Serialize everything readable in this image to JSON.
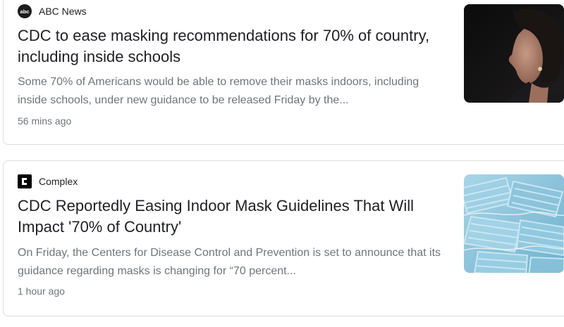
{
  "articles": [
    {
      "source": "ABC News",
      "source_icon": "abc-news-logo-icon",
      "headline": "CDC to ease masking recommendations for 70% of country, including inside schools",
      "snippet": "Some 70% of Americans would be able to remove their masks indoors, including inside schools, under new guidance to be released Friday by the...",
      "time": "56 mins ago",
      "thumbnail": "woman-speaking-portrait-image"
    },
    {
      "source": "Complex",
      "source_icon": "complex-logo-icon",
      "headline": "CDC Reportedly Easing Indoor Mask Guidelines That Will Impact '70% of Country'",
      "snippet": "On Friday, the Centers for Disease Control and Prevention is set to announce that its guidance regarding masks is changing for “70 percent...",
      "time": "1 hour ago",
      "thumbnail": "surgical-masks-pile-image"
    }
  ],
  "colors": {
    "headline": "#202124",
    "snippet": "#70757a",
    "border": "#dadce0",
    "mask_blue": "#8ec5dc"
  }
}
